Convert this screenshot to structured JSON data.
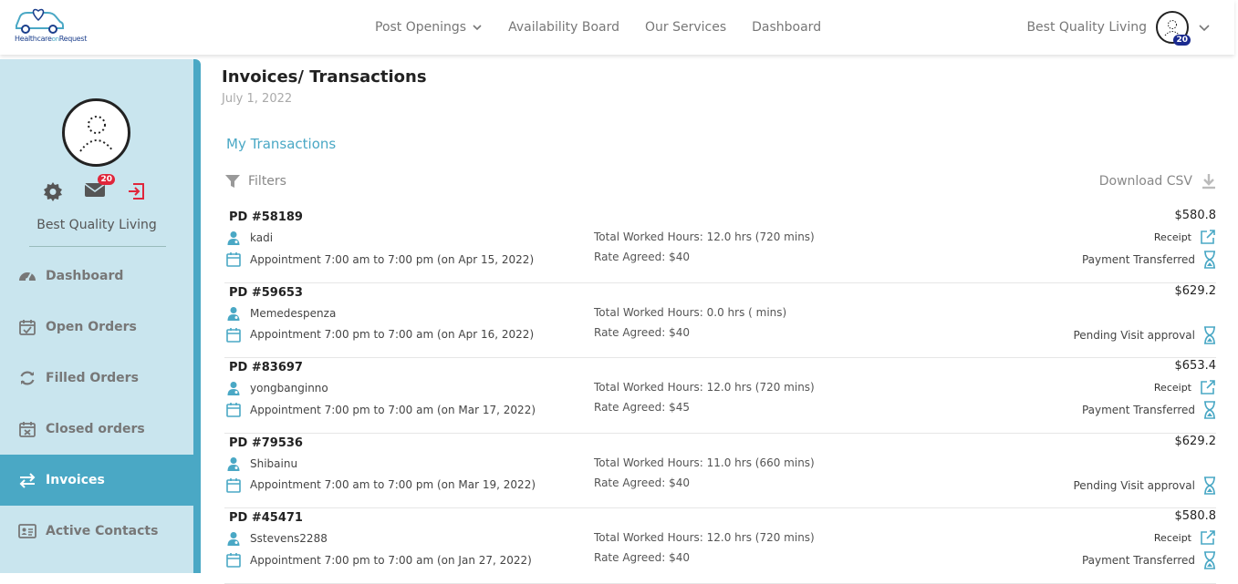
{
  "brand": {
    "logo_text_a": "Healthcare",
    "logo_text_b": "on",
    "logo_text_c": "Request"
  },
  "nav": {
    "items": [
      {
        "label": "Post Openings"
      },
      {
        "label": "Availability Board"
      },
      {
        "label": "Our Services"
      },
      {
        "label": "Dashboard"
      }
    ]
  },
  "user": {
    "name": "Best Quality Living",
    "notifications": "20"
  },
  "sidebar": {
    "profile_name": "Best Quality Living",
    "mail_count": "20",
    "items": [
      {
        "label": "Dashboard",
        "icon": "dashboard-icon"
      },
      {
        "label": "Open Orders",
        "icon": "calendar-check-icon"
      },
      {
        "label": "Filled Orders",
        "icon": "refresh-icon"
      },
      {
        "label": "Closed orders",
        "icon": "calendar-x-icon"
      },
      {
        "label": "Invoices",
        "icon": "transfer-icon"
      },
      {
        "label": "Active Contacts",
        "icon": "contact-card-icon"
      }
    ]
  },
  "main": {
    "title": "Invoices/ Transactions",
    "date": "July 1, 2022",
    "section_title": "My Transactions",
    "filters_label": "Filters",
    "download_label": "Download CSV",
    "transactions": [
      {
        "id": "PD #58189",
        "user": "kadi",
        "appointment": "Appointment 7:00 am to 7:00 pm (on Apr 15, 2022)",
        "hours": "Total Worked Hours: 12.0 hrs (720 mins)",
        "rate": "Rate Agreed: $40",
        "amount": "$580.8",
        "receipt": "Receipt",
        "status": "Payment Transferred"
      },
      {
        "id": "PD #59653",
        "user": "Memedespenza",
        "appointment": "Appointment 7:00 pm to 7:00 am (on Apr 16, 2022)",
        "hours": "Total Worked Hours: 0.0 hrs ( mins)",
        "rate": "Rate Agreed: $40",
        "amount": "$629.2",
        "receipt": "",
        "status": "Pending Visit approval"
      },
      {
        "id": "PD #83697",
        "user": "yongbanginno",
        "appointment": "Appointment 7:00 pm to 7:00 am (on Mar 17, 2022)",
        "hours": "Total Worked Hours: 12.0 hrs (720 mins)",
        "rate": "Rate Agreed: $45",
        "amount": "$653.4",
        "receipt": "Receipt",
        "status": "Payment Transferred"
      },
      {
        "id": "PD #79536",
        "user": "Shibainu",
        "appointment": "Appointment 7:00 am to 7:00 pm (on Mar 19, 2022)",
        "hours": "Total Worked Hours: 11.0 hrs (660 mins)",
        "rate": "Rate Agreed: $40",
        "amount": "$629.2",
        "receipt": "",
        "status": "Pending Visit approval"
      },
      {
        "id": "PD #45471",
        "user": "Sstevens2288",
        "appointment": "Appointment 7:00 pm to 7:00 am (on Jan 27, 2022)",
        "hours": "Total Worked Hours: 12.0 hrs (720 mins)",
        "rate": "Rate Agreed: $40",
        "amount": "$580.8",
        "receipt": "Receipt",
        "status": "Payment Transferred"
      }
    ]
  },
  "colors": {
    "accent": "#4aa8c5",
    "sidebar_bg": "#c9e5ee",
    "badge_red": "#e0263b",
    "badge_navy": "#1a2a8f"
  }
}
